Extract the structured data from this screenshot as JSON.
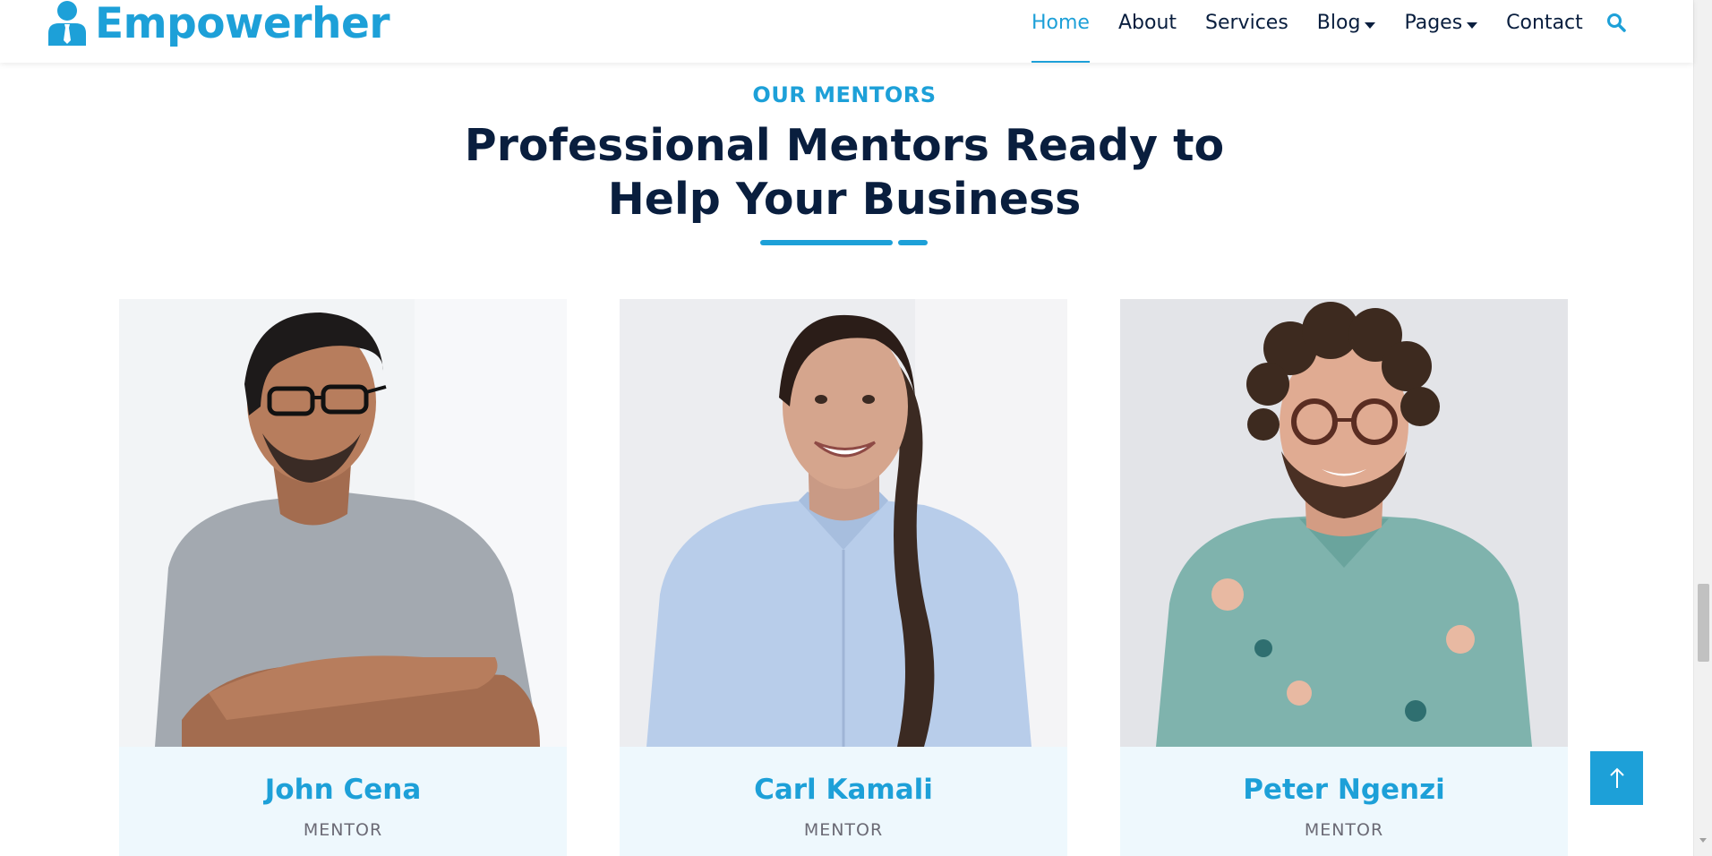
{
  "brand": {
    "name": "Empowerher",
    "icon": "user-tie-icon"
  },
  "nav": {
    "items": [
      {
        "label": "Home",
        "active": true
      },
      {
        "label": "About"
      },
      {
        "label": "Services"
      },
      {
        "label": "Blog",
        "dropdown": true
      },
      {
        "label": "Pages",
        "dropdown": true
      },
      {
        "label": "Contact"
      }
    ],
    "search_icon": "search-icon"
  },
  "section": {
    "tag": "OUR MENTORS",
    "title_line1": "Professional Mentors Ready to",
    "title_line2": "Help Your Business"
  },
  "mentors": [
    {
      "name": "John Cena",
      "role": "MENTOR"
    },
    {
      "name": "Carl Kamali",
      "role": "MENTOR"
    },
    {
      "name": "Peter Ngenzi",
      "role": "MENTOR"
    }
  ],
  "back_to_top": {
    "icon": "arrow-up-icon"
  },
  "colors": {
    "primary": "#1da0d8",
    "dark": "#091e3e",
    "card_bg": "#eef8fd",
    "muted": "#6b6a75"
  }
}
